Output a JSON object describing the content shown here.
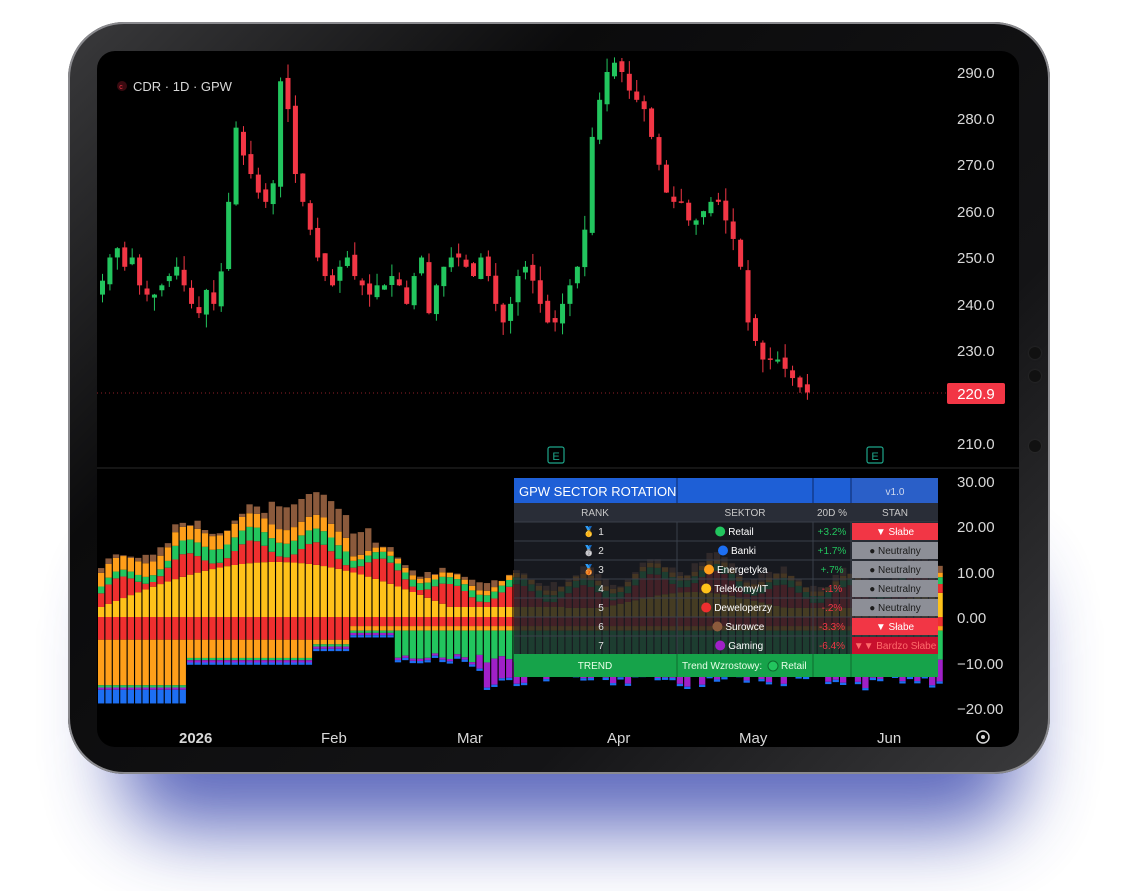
{
  "symbol": {
    "label": "CDR · 1D · GPW"
  },
  "price_axis": {
    "ticks": [
      "290.0",
      "280.0",
      "270.0",
      "260.0",
      "250.0",
      "240.0",
      "230.0",
      "210.0"
    ],
    "last_price": "220.9",
    "last_price_color": "#f23645"
  },
  "osc_axis": {
    "ticks": [
      "30.00",
      "20.00",
      "10.00",
      "0.00",
      "−10.00",
      "−20.00"
    ]
  },
  "time_axis": {
    "labels": [
      "2026",
      "Feb",
      "Mar",
      "Apr",
      "May",
      "Jun"
    ]
  },
  "events": {
    "earnings_marker": "E"
  },
  "colors": {
    "up": "#22c55e",
    "down": "#f23645",
    "panel_header": "#1e5fd6",
    "trend_row": "#16a34a"
  },
  "chart_data": {
    "type": "candlestick",
    "title": "CDR · 1D · GPW",
    "ylim": [
      205,
      295
    ],
    "close_prices": [
      245,
      250,
      252,
      248,
      250,
      244,
      242,
      242,
      244,
      246,
      248,
      244,
      240,
      238,
      243,
      240,
      247,
      262,
      278,
      272,
      268,
      264,
      262,
      266,
      288,
      282,
      268,
      262,
      256,
      250,
      246,
      244,
      248,
      250,
      246,
      244,
      242,
      244,
      244,
      246,
      244,
      240,
      246,
      250,
      238,
      244,
      248,
      250,
      250,
      248,
      246,
      250,
      246,
      240,
      236,
      240,
      246,
      248,
      245,
      240,
      236,
      236,
      240,
      244,
      248,
      256,
      276,
      284,
      290,
      292,
      290,
      286,
      284,
      282,
      276,
      270,
      264,
      262,
      262,
      258,
      258,
      260,
      262,
      262,
      258,
      254,
      248,
      236,
      232,
      228,
      228,
      228,
      226,
      224,
      222,
      220.9
    ],
    "oscillator_range": [
      -20,
      30
    ],
    "series": [
      {
        "name": "Retail",
        "color": "#22c55e"
      },
      {
        "name": "Banki",
        "color": "#1d6ff2"
      },
      {
        "name": "Energetyka",
        "color": "#ff9f1a"
      },
      {
        "name": "Telekomy/IT",
        "color": "#ffc21a"
      },
      {
        "name": "Deweloperzy",
        "color": "#ef2f2f"
      },
      {
        "name": "Surowce",
        "color": "#8b5a3c"
      },
      {
        "name": "Gaming",
        "color": "#a020c8"
      }
    ]
  },
  "table": {
    "title": "GPW SECTOR ROTATION",
    "version": "v1.0",
    "headers": [
      "RANK",
      "SEKTOR",
      "20D %",
      "STAN"
    ],
    "rows": [
      {
        "medal": "🥇",
        "rank": "1",
        "dot_color": "#22c55e",
        "sector": "Retail",
        "pct": "+3.2%",
        "pct_color": "#22c55e",
        "state": "▼ Słabe",
        "state_bg": "#f23645",
        "state_fg": "#ffffff"
      },
      {
        "medal": "🥈",
        "rank": "2",
        "dot_color": "#1d6ff2",
        "sector": "Banki",
        "pct": "+1.7%",
        "pct_color": "#22c55e",
        "state": "● Neutralny",
        "state_bg": "#8d8f97",
        "state_fg": "#1c1c1c"
      },
      {
        "medal": "🥉",
        "rank": "3",
        "dot_color": "#ff9f1a",
        "sector": "Energetyka",
        "pct": "+.7%",
        "pct_color": "#22c55e",
        "state": "● Neutralny",
        "state_bg": "#8d8f97",
        "state_fg": "#1c1c1c"
      },
      {
        "medal": "",
        "rank": "4",
        "dot_color": "#ffc21a",
        "sector": "Telekomy/IT",
        "pct": "-.1%",
        "pct_color": "#f23645",
        "state": "● Neutralny",
        "state_bg": "#8d8f97",
        "state_fg": "#1c1c1c"
      },
      {
        "medal": "",
        "rank": "5",
        "dot_color": "#ef2f2f",
        "sector": "Deweloperzy",
        "pct": "-.2%",
        "pct_color": "#f23645",
        "state": "● Neutralny",
        "state_bg": "#8d8f97",
        "state_fg": "#1c1c1c"
      },
      {
        "medal": "",
        "rank": "6",
        "dot_color": "#8b5a3c",
        "sector": "Surowce",
        "pct": "-3.3%",
        "pct_color": "#f23645",
        "state": "▼ Słabe",
        "state_bg": "#f23645",
        "state_fg": "#ffffff"
      },
      {
        "medal": "",
        "rank": "7",
        "dot_color": "#a020c8",
        "sector": "Gaming",
        "pct": "-6.4%",
        "pct_color": "#f23645",
        "state": "▼▼ Bardzo Słabe",
        "state_bg": "#c8102e",
        "state_fg": "#ff6b6b"
      }
    ],
    "trend": {
      "label": "TREND",
      "text": "Trend Wzrostowy:",
      "dot_color": "#22c55e",
      "sector": "Retail"
    }
  }
}
